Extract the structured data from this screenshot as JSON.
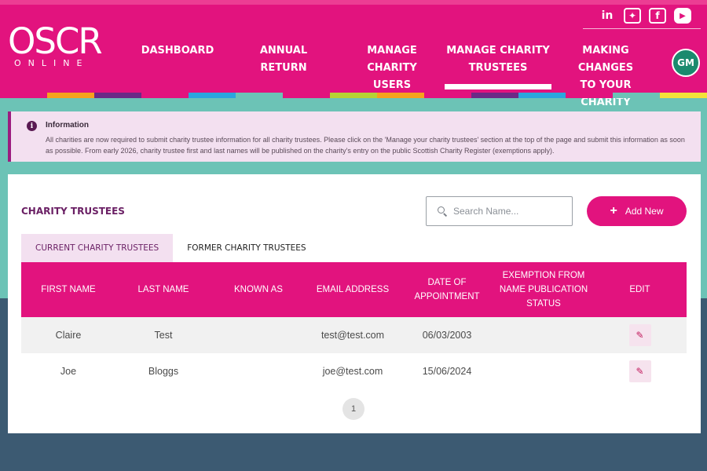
{
  "brand": {
    "logo_main": "OSCR",
    "logo_sub": "ONLINE",
    "accent": "#e2137e",
    "teal": "#6cc3b6"
  },
  "social": [
    {
      "name": "linkedin-icon",
      "glyph": "in"
    },
    {
      "name": "twitter-icon",
      "glyph": "✦"
    },
    {
      "name": "facebook-icon",
      "glyph": "f"
    },
    {
      "name": "youtube-icon",
      "glyph": "▶"
    }
  ],
  "nav": {
    "dashboard": "DASHBOARD",
    "annual_return": "ANNUAL\nRETURN",
    "manage_users": "MANAGE CHARITY\nUSERS",
    "manage_trustees": "MANAGE CHARITY\nTRUSTEES",
    "making_changes": "MAKING CHANGES\nTO YOUR CHARITY"
  },
  "user": {
    "initials": "GM"
  },
  "color_strip": [
    "#e2137e",
    "#f6a21d",
    "#6b2a86",
    "#e2137e",
    "#2ba6de",
    "#6cc3b6",
    "#e2137e",
    "#b6d334",
    "#f6a21d",
    "#e2137e",
    "#6b2a86",
    "#2ba6de",
    "#e2137e",
    "#6cc3b6",
    "#f3e23a"
  ],
  "info": {
    "title": "Information",
    "text": "All charities are now required to submit charity trustee information for all charity trustees. Please click on the 'Manage your charity trustees' section at the top of the page and submit this information as soon as possible. From early 2026, charity trustee first and last names will be published on the charity's entry on the public Scottish Charity Register (exemptions apply)."
  },
  "card": {
    "title": "CHARITY TRUSTEES",
    "search_placeholder": "Search Name...",
    "add_label": "Add New",
    "tabs": {
      "current": "CURRENT CHARITY TRUSTEES",
      "former": "FORMER CHARITY TRUSTEES"
    }
  },
  "table": {
    "headers": {
      "first_name": "FIRST NAME",
      "last_name": "LAST NAME",
      "known_as": "KNOWN AS",
      "email": "EMAIL ADDRESS",
      "date": "DATE OF\nAPPOINTMENT",
      "exemption": "EXEMPTION FROM\nNAME PUBLICATION\nSTATUS",
      "edit": "EDIT"
    },
    "rows": [
      {
        "first": "Claire",
        "last": "Test",
        "known_as": "",
        "email": "test@test.com",
        "date": "06/03/2003",
        "exemption": ""
      },
      {
        "first": "Joe",
        "last": "Bloggs",
        "known_as": "",
        "email": "joe@test.com",
        "date": "15/06/2024",
        "exemption": ""
      }
    ]
  },
  "pager": {
    "page": "1"
  }
}
